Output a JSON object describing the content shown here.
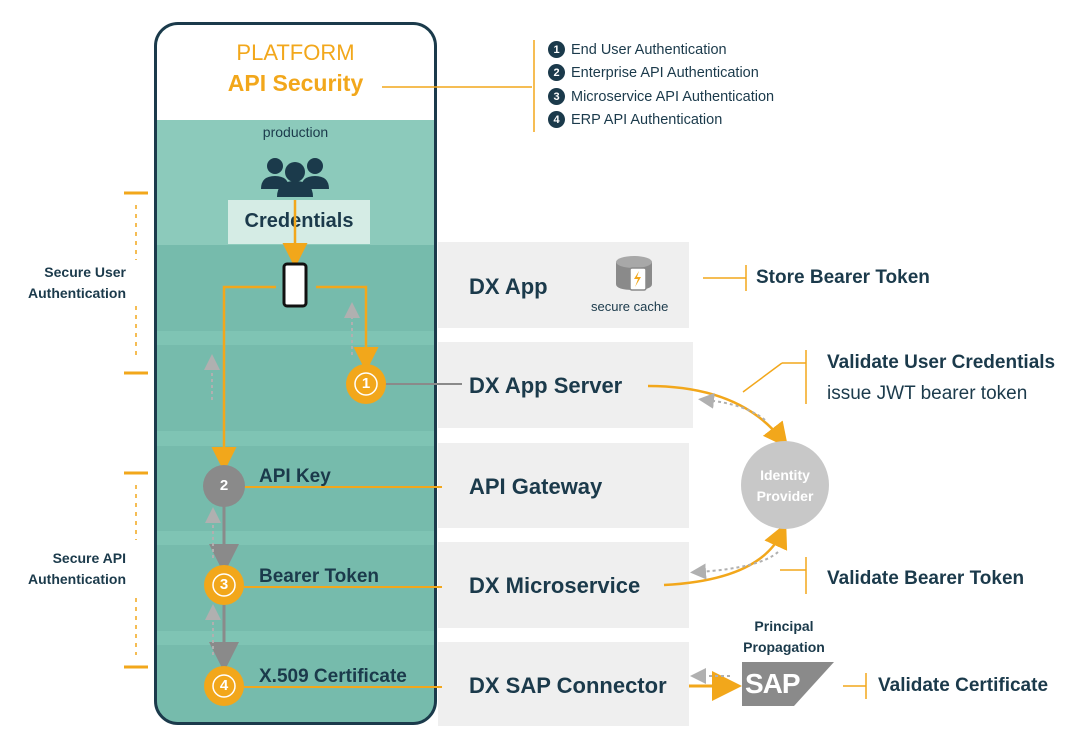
{
  "platform": {
    "title": "PLATFORM",
    "subtitle": "API Security",
    "environment": "production",
    "credentials_label": "Credentials"
  },
  "legend": [
    {
      "num": "1",
      "label": "End User Authentication"
    },
    {
      "num": "2",
      "label": "Enterprise API Authentication"
    },
    {
      "num": "3",
      "label": "Microservice API Authentication"
    },
    {
      "num": "4",
      "label": "ERP API Authentication"
    }
  ],
  "side_labels": {
    "user_auth_line1": "Secure User",
    "user_auth_line2": "Authentication",
    "api_auth_line1": "Secure API",
    "api_auth_line2": "Authentication"
  },
  "steps": [
    {
      "num": "1",
      "label": ""
    },
    {
      "num": "2",
      "label": "API Key"
    },
    {
      "num": "3",
      "label": "Bearer Token"
    },
    {
      "num": "4",
      "label": "X.509 Certificate"
    }
  ],
  "components": {
    "dx_app": "DX App",
    "secure_cache": "secure cache",
    "dx_app_server": "DX App Server",
    "api_gateway": "API Gateway",
    "dx_microservice": "DX Microservice",
    "dx_sap_connector": "DX SAP Connector"
  },
  "identity_provider": {
    "line1": "Identity",
    "line2": "Provider"
  },
  "principal_propagation": {
    "line1": "Principal",
    "line2": "Propagation"
  },
  "sap_logo": "SAP",
  "notes": {
    "store_bearer_token": "Store Bearer Token",
    "validate_user_credentials": "Validate User Credentials",
    "issue_jwt": "issue JWT bearer token",
    "validate_bearer_token": "Validate Bearer Token",
    "validate_certificate": "Validate Certificate"
  },
  "colors": {
    "accent": "#f2a71b",
    "navy": "#1b3a4b",
    "teal": "#7fc4b4",
    "row_bg": "#efefef",
    "grey_node": "#8a8a8a",
    "identity_provider": "#c8c8c8"
  }
}
